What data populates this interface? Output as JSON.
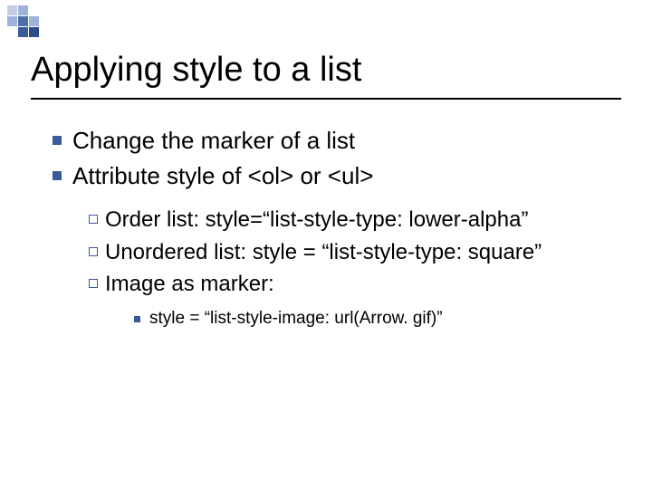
{
  "title": "Applying style to a list",
  "bullets": {
    "b1": "Change the marker of a list",
    "b2": "Attribute style of <ol> or <ul>",
    "sub": {
      "s1": "Order list: style=“list-style-type: lower-alpha”",
      "s2": "Unordered list: style = “list-style-type: square”",
      "s3": "Image as marker:",
      "s3a": "style = “list-style-image: url(Arrow. gif)”"
    }
  }
}
